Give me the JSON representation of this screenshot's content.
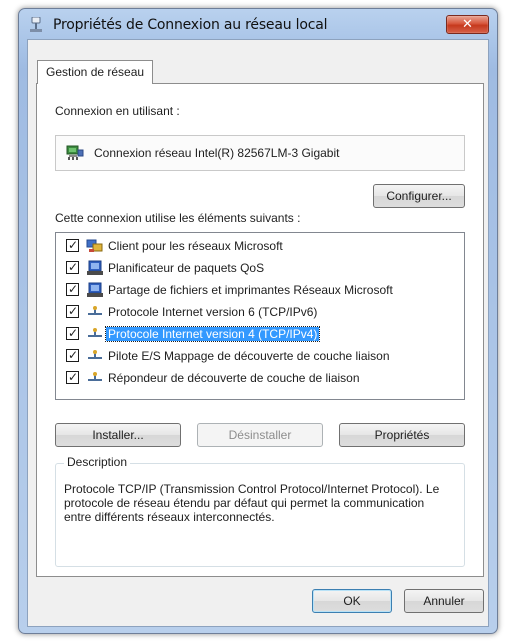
{
  "window": {
    "title": "Propriétés de Connexion au réseau local",
    "close_label": "✕"
  },
  "tab": {
    "label": "Gestion de réseau"
  },
  "connect_using": {
    "label": "Connexion en utilisant :",
    "adapter": "Connexion réseau Intel(R) 82567LM-3 Gigabit",
    "configure_button": "Configurer..."
  },
  "components": {
    "label": "Cette connexion utilise les éléments suivants :",
    "items": [
      {
        "label": "Client pour les réseaux Microsoft",
        "checked": true,
        "icon": "network-client-icon"
      },
      {
        "label": "Planificateur de paquets QoS",
        "checked": true,
        "icon": "service-icon"
      },
      {
        "label": "Partage de fichiers et imprimantes Réseaux Microsoft",
        "checked": true,
        "icon": "service-icon"
      },
      {
        "label": "Protocole Internet version 6 (TCP/IPv6)",
        "checked": true,
        "icon": "protocol-icon"
      },
      {
        "label": "Protocole Internet version 4 (TCP/IPv4)",
        "checked": true,
        "icon": "protocol-icon",
        "selected": true
      },
      {
        "label": "Pilote E/S Mappage de découverte de couche liaison",
        "checked": true,
        "icon": "protocol-icon"
      },
      {
        "label": "Répondeur de découverte de couche de liaison",
        "checked": true,
        "icon": "protocol-icon"
      }
    ]
  },
  "actions": {
    "install": "Installer...",
    "uninstall": "Désinstaller",
    "properties": "Propriétés"
  },
  "description": {
    "legend": "Description",
    "text": "Protocole TCP/IP (Transmission Control Protocol/Internet Protocol). Le protocole de réseau étendu par défaut qui permet la communication entre différents réseaux interconnectés."
  },
  "footer": {
    "ok": "OK",
    "cancel": "Annuler"
  },
  "colors": {
    "selection": "#3399ff",
    "title_gradient": "#aac5e8",
    "close_red": "#c6391d"
  }
}
